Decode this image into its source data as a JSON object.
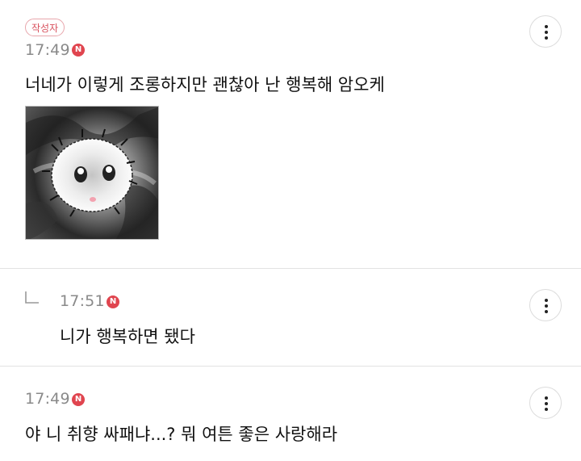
{
  "comments": [
    {
      "author_badge": "작성자",
      "time": "17:49",
      "n_badge": "N",
      "text": "너네가 이렇게 조롱하지만 괜찮아 난 행복해 암오케",
      "attachment": "image"
    },
    {
      "reply": true,
      "time": "17:51",
      "n_badge": "N",
      "text": "니가 행복하면 됐다"
    },
    {
      "time": "17:49",
      "n_badge": "N",
      "text": "야 니 취향 싸패냐...? 뭐 여튼 좋은 사랑해라"
    }
  ],
  "icons": {
    "more": "more-vertical-icon",
    "reply": "reply-arrow-icon",
    "new": "new-badge-icon"
  },
  "colors": {
    "accent": "#e0454f",
    "badge_border": "#e8a6ac",
    "badge_text": "#d9535f",
    "time": "#8a8a8a",
    "divider": "#e3e3e3"
  }
}
